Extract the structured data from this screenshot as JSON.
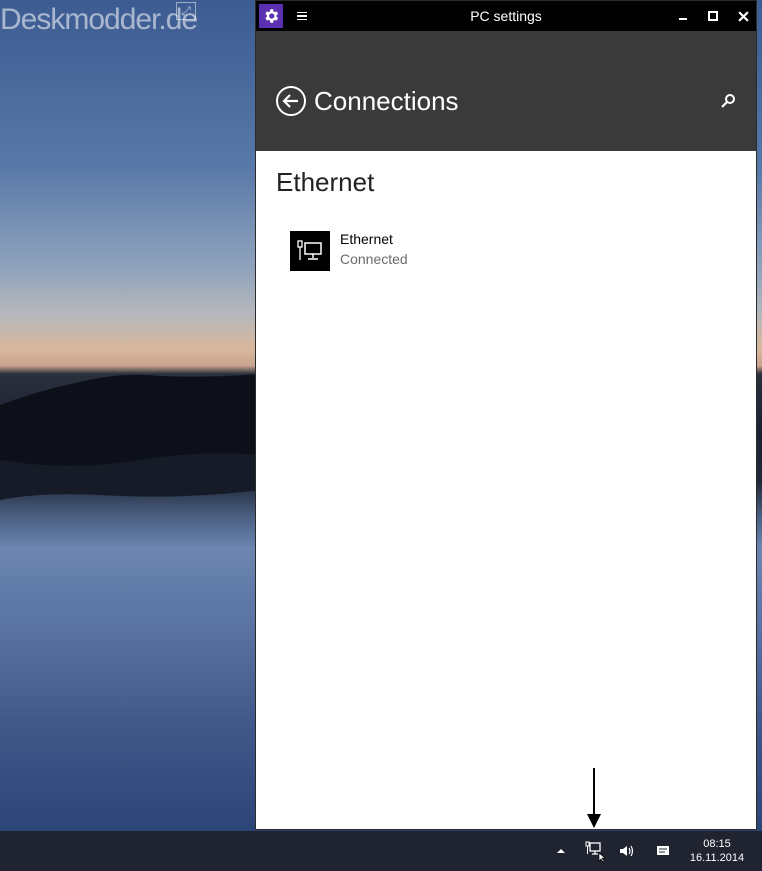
{
  "desktop": {
    "watermark": "Deskmodder.de"
  },
  "window": {
    "title": "PC settings",
    "header": {
      "title": "Connections"
    },
    "section": {
      "heading": "Ethernet",
      "item": {
        "name": "Ethernet",
        "status": "Connected"
      }
    }
  },
  "taskbar": {
    "time": "08:15",
    "date": "16.11.2014"
  },
  "colors": {
    "app_icon": "#5b2fb1",
    "header_bg": "#3a3a3a",
    "titlebar_bg": "#000000",
    "taskbar_bg": "#1f2430"
  },
  "icons": {
    "app": "gear-icon",
    "back": "back-arrow-icon",
    "search": "search-icon",
    "network": "ethernet-icon"
  }
}
